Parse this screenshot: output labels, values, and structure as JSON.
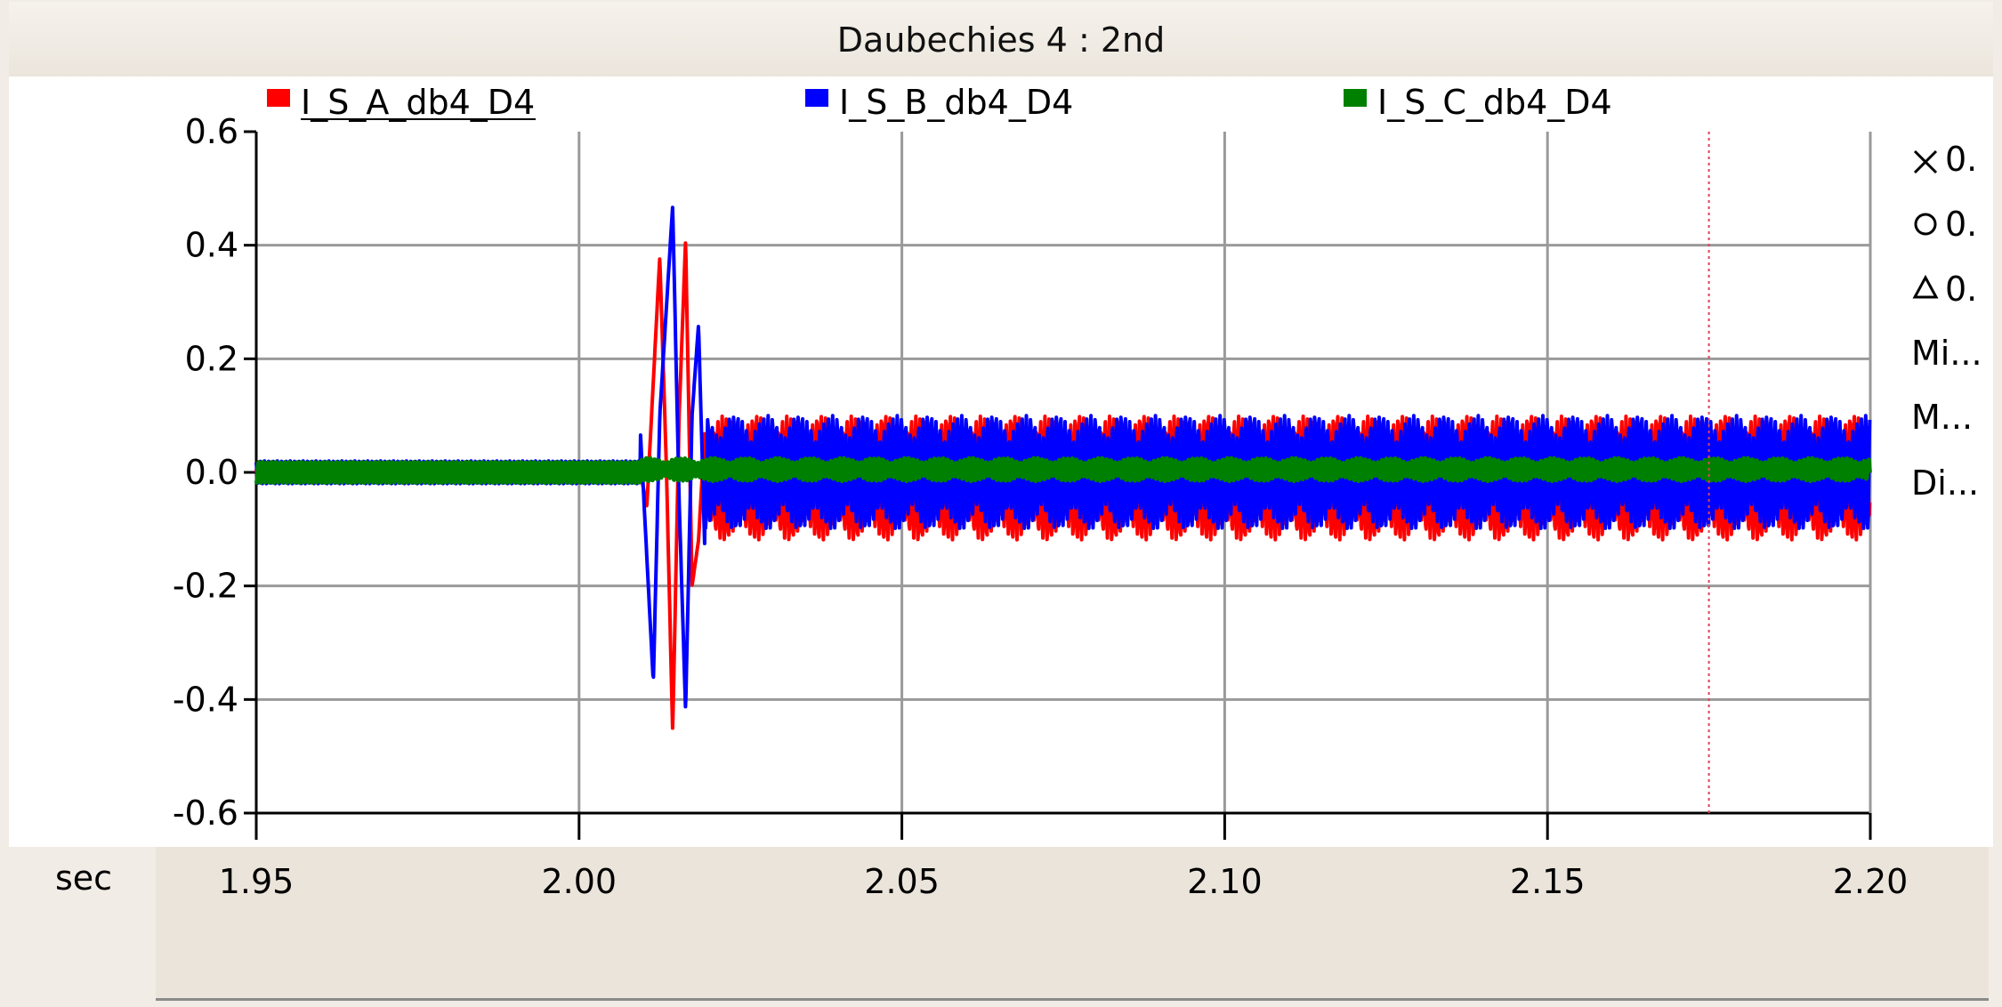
{
  "window": {
    "title": "Daubechies 4 : 2nd"
  },
  "side_panel": {
    "items": [
      {
        "icon": "cross-marker-icon",
        "label": "0."
      },
      {
        "icon": "circle-marker-icon",
        "label": "0."
      },
      {
        "icon": "triangle-marker-icon",
        "label": "0."
      },
      {
        "label": "Mi..."
      },
      {
        "label": "M..."
      },
      {
        "label": "Di..."
      }
    ]
  },
  "chart_data": {
    "type": "line",
    "title": "Daubechies 4 : 2nd",
    "xlabel": "sec",
    "ylabel": "",
    "xlim": [
      1.95,
      2.2
    ],
    "ylim": [
      -0.6,
      0.6
    ],
    "x_ticks": [
      "1.95",
      "2.00",
      "2.05",
      "2.10",
      "2.15",
      "2.20"
    ],
    "y_ticks": [
      "0.6",
      "0.4",
      "0.2",
      "0.0",
      "-0.2",
      "-0.4",
      "-0.6"
    ],
    "grid": true,
    "legend_position": "top",
    "cursor_x": 2.175,
    "series": [
      {
        "name": "I_S_A_db4_D4",
        "color": "#ff0000",
        "pre_fault_amplitude": 0.015,
        "transient": [
          [
            2.0095,
            0.0
          ],
          [
            2.0105,
            -0.06
          ],
          [
            2.0125,
            0.38
          ],
          [
            2.0135,
            0.02
          ],
          [
            2.0145,
            -0.46
          ],
          [
            2.0155,
            0.1
          ],
          [
            2.0165,
            0.41
          ],
          [
            2.0175,
            -0.2
          ],
          [
            2.0185,
            -0.12
          ],
          [
            2.0195,
            0.08
          ]
        ],
        "steady_amplitude": 0.11,
        "steady_offset": -0.01
      },
      {
        "name": "I_S_B_db4_D4",
        "color": "#0000ff",
        "pre_fault_amplitude": 0.02,
        "transient": [
          [
            2.0075,
            0.03
          ],
          [
            2.0095,
            0.07
          ],
          [
            2.0115,
            -0.37
          ],
          [
            2.0125,
            0.1
          ],
          [
            2.0145,
            0.47
          ],
          [
            2.0155,
            -0.05
          ],
          [
            2.0165,
            -0.42
          ],
          [
            2.0175,
            0.1
          ],
          [
            2.0185,
            0.26
          ],
          [
            2.0195,
            -0.15
          ]
        ],
        "steady_amplitude": 0.1,
        "steady_offset": 0.0
      },
      {
        "name": "I_S_C_db4_D4",
        "color": "#008000",
        "pre_fault_amplitude": 0.018,
        "transient": [],
        "steady_amplitude": 0.02,
        "steady_offset": 0.005
      }
    ]
  }
}
